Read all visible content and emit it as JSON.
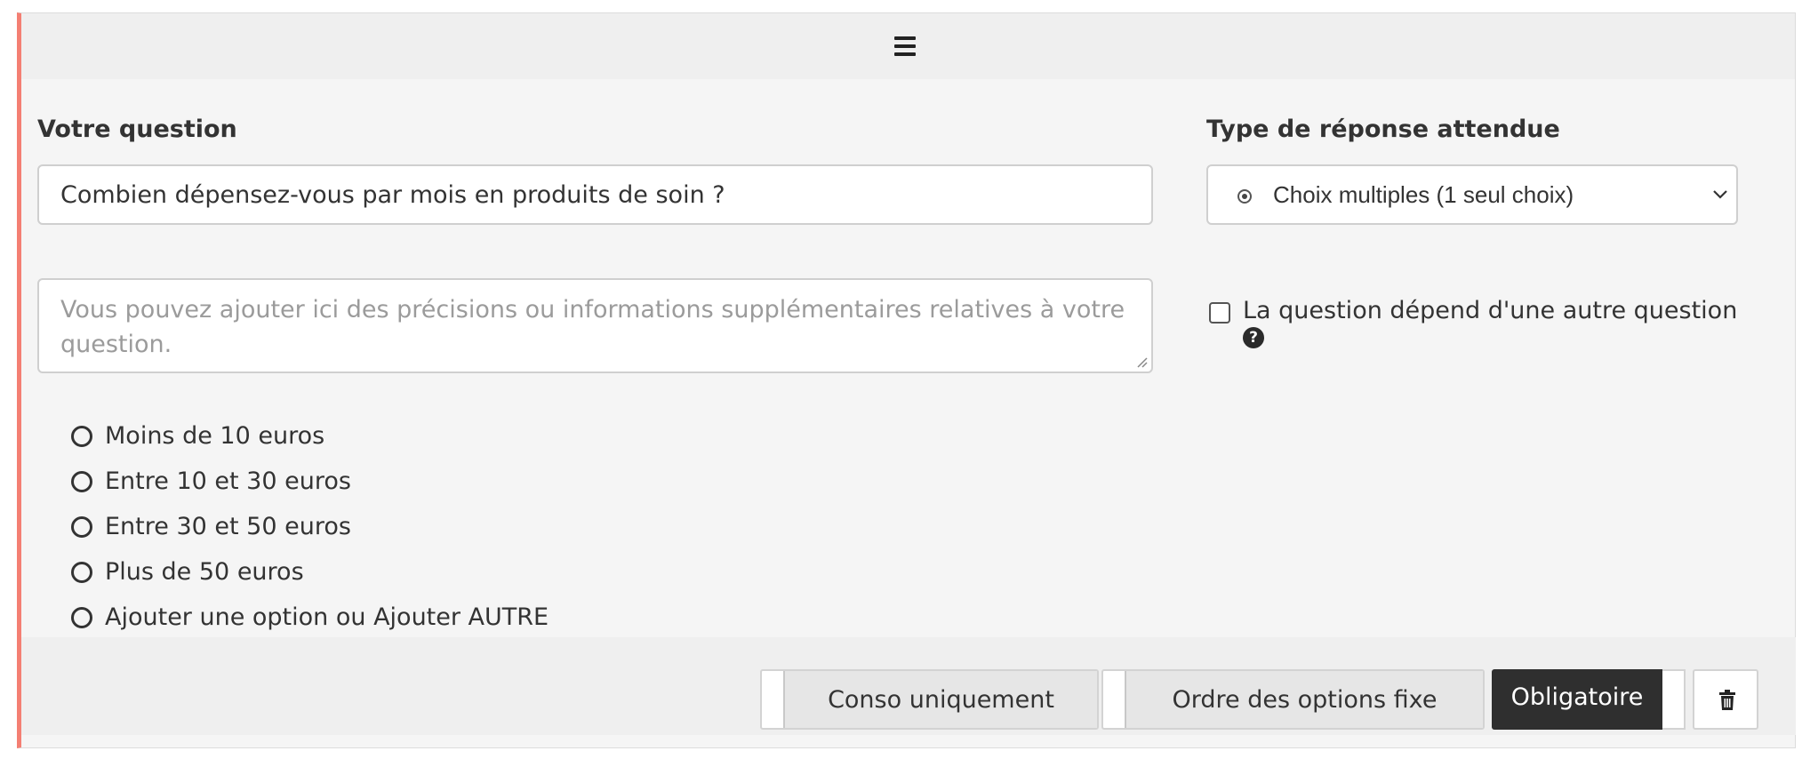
{
  "question": {
    "label": "Votre question",
    "value": "Combien dépensez-vous par mois en produits de soin ?",
    "description_placeholder": "Vous pouvez ajouter ici des précisions ou informations supplémentaires relatives à votre question."
  },
  "answer_type": {
    "label": "Type de réponse attendue",
    "selected": "Choix multiples (1 seul choix)",
    "icon": "radio-dot-icon"
  },
  "dependency": {
    "label": "La question dépend d'une autre question",
    "checked": false,
    "help_glyph": "?"
  },
  "options": [
    {
      "label": "Moins de 10 euros"
    },
    {
      "label": "Entre 10 et 30 euros"
    },
    {
      "label": "Entre 30 et 50 euros"
    },
    {
      "label": "Plus de 50 euros"
    },
    {
      "label": "Ajouter une option ou Ajouter AUTRE"
    }
  ],
  "footer": {
    "conso_label": "Conso uniquement",
    "ordre_label": "Ordre des options fixe",
    "required_label": "Obligatoire"
  },
  "colors": {
    "accent_border": "#f47f73",
    "required_bg": "#2f2f2f"
  }
}
